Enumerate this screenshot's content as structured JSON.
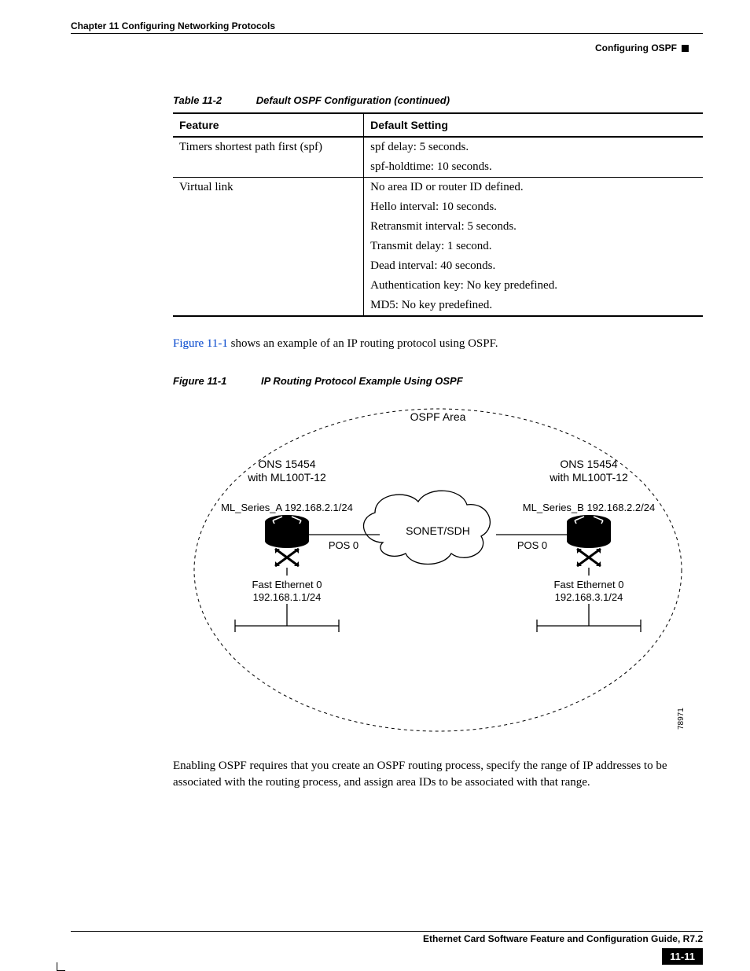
{
  "header": {
    "chapter": "Chapter 11 Configuring Networking Protocols",
    "section": "Configuring OSPF"
  },
  "table": {
    "caption_label": "Table 11-2",
    "caption_title": "Default OSPF Configuration (continued)",
    "col_feature": "Feature",
    "col_default": "Default Setting",
    "rows": [
      {
        "feature": "Timers shortest path first (spf)",
        "settings": [
          "spf delay: 5 seconds.",
          "spf-holdtime: 10 seconds."
        ]
      },
      {
        "feature": "Virtual link",
        "settings": [
          "No area ID or router ID defined.",
          "Hello interval: 10 seconds.",
          "Retransmit interval: 5 seconds.",
          "Transmit delay: 1 second.",
          "Dead interval: 40 seconds.",
          "Authentication key: No key predefined.",
          "MD5: No key predefined."
        ]
      }
    ]
  },
  "para1_link": "Figure 11-1",
  "para1_rest": " shows an example of an IP routing protocol using OSPF.",
  "figure": {
    "caption_label": "Figure 11-1",
    "caption_title": "IP Routing Protocol Example Using OSPF",
    "ospf_area": "OSPF Area",
    "sonet": "SONET/SDH",
    "dev_a_line1": "ONS 15454",
    "dev_a_line2": "with ML100T-12",
    "dev_a_name": "ML_Series_A 192.168.2.1/24",
    "dev_a_pos": "POS 0",
    "dev_a_fe_line1": "Fast Ethernet 0",
    "dev_a_fe_line2": "192.168.1.1/24",
    "dev_b_line1": "ONS 15454",
    "dev_b_line2": "with ML100T-12",
    "dev_b_name": "ML_Series_B 192.168.2.2/24",
    "dev_b_pos": "POS 0",
    "dev_b_fe_line1": "Fast Ethernet 0",
    "dev_b_fe_line2": "192.168.3.1/24",
    "fig_id": "78971"
  },
  "para2": "Enabling OSPF requires that you create an OSPF routing process, specify the range of IP addresses to be associated with the routing process, and assign area IDs to be associated with that range.",
  "footer": {
    "title": "Ethernet Card Software Feature and Configuration Guide, R7.2",
    "page": "11-11"
  }
}
